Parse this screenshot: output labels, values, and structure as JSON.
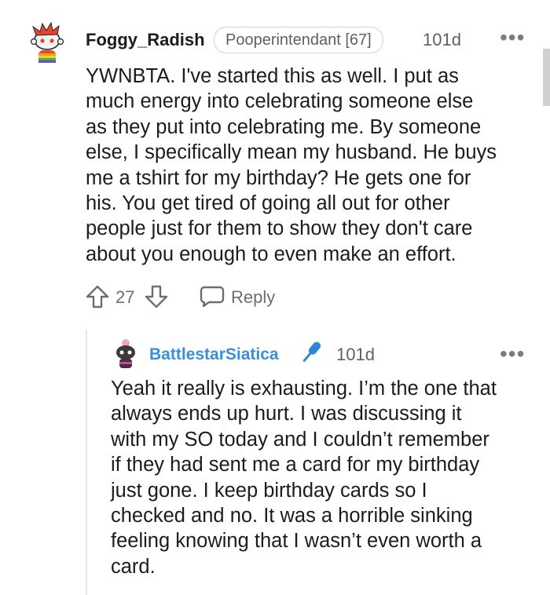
{
  "comment": {
    "username": "Foggy_Radish",
    "flair": "Pooperintendant [67]",
    "age": "101d",
    "more_label": "•••",
    "body_lines": [
      "YWNBTA. I've started this as well. I put as",
      "much energy into celebrating someone else",
      "as they put into celebrating me. By someone",
      "else, I specifically mean my husband. He buys",
      "me a tshirt for my birthday? He gets one for",
      "his. You get tired of going all out for other",
      "people just for them to show they don't care",
      "about you enough to even make an effort."
    ],
    "vote_count": "27",
    "reply_label": "Reply"
  },
  "reply": {
    "username": "BattlestarSiatica",
    "age": "101d",
    "more_label": "•••",
    "body_lines": [
      "Yeah it really is exhausting. I’m the one that",
      "always ends up hurt. I was discussing it",
      "with my SO today and I couldn’t remember",
      "if they had sent me a card for my birthday",
      "just gone. I keep birthday cards so I",
      "checked and no. It was a horrible sinking",
      "feeling knowing that I wasn’t even worth a",
      "card."
    ]
  },
  "icons": {
    "avatar_main": "snoo-avatar-icon",
    "avatar_reply": "snoo-avatar-icon",
    "upvote": "upvote-arrow-icon",
    "downvote": "downvote-arrow-icon",
    "reply": "speech-bubble-icon",
    "badge": "microphone-icon"
  },
  "colors": {
    "reply_username": "#3a8fd6",
    "mic_badge": "#2f86d8"
  }
}
